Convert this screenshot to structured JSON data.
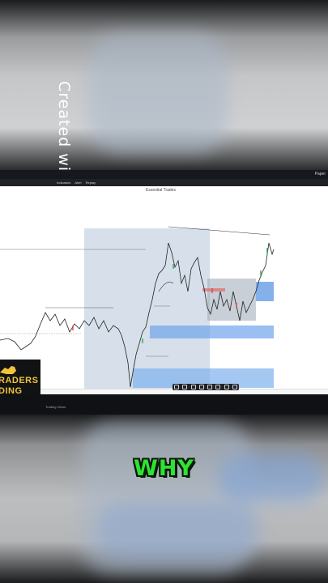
{
  "watermark": {
    "text": "Created with",
    "logo_icon": "p-logo-icon"
  },
  "platform": {
    "toolbar_items": [
      "Indicators",
      "Alert",
      "Replay"
    ],
    "account_label": "Paper",
    "chart_title": "Essential Trades",
    "status_text": "Trading Views"
  },
  "brand_logo": {
    "line1": "RADERS",
    "line2": "DING",
    "icon": "bull-icon"
  },
  "caption": {
    "text": "WHY",
    "color": "#2fe234"
  },
  "colors": {
    "zone_gray": "#9fb0c4",
    "zone_blue": "#4d8ee0",
    "zone_red": "#e06a6a",
    "candle": "#222222",
    "candle_green": "#2fa84f"
  }
}
